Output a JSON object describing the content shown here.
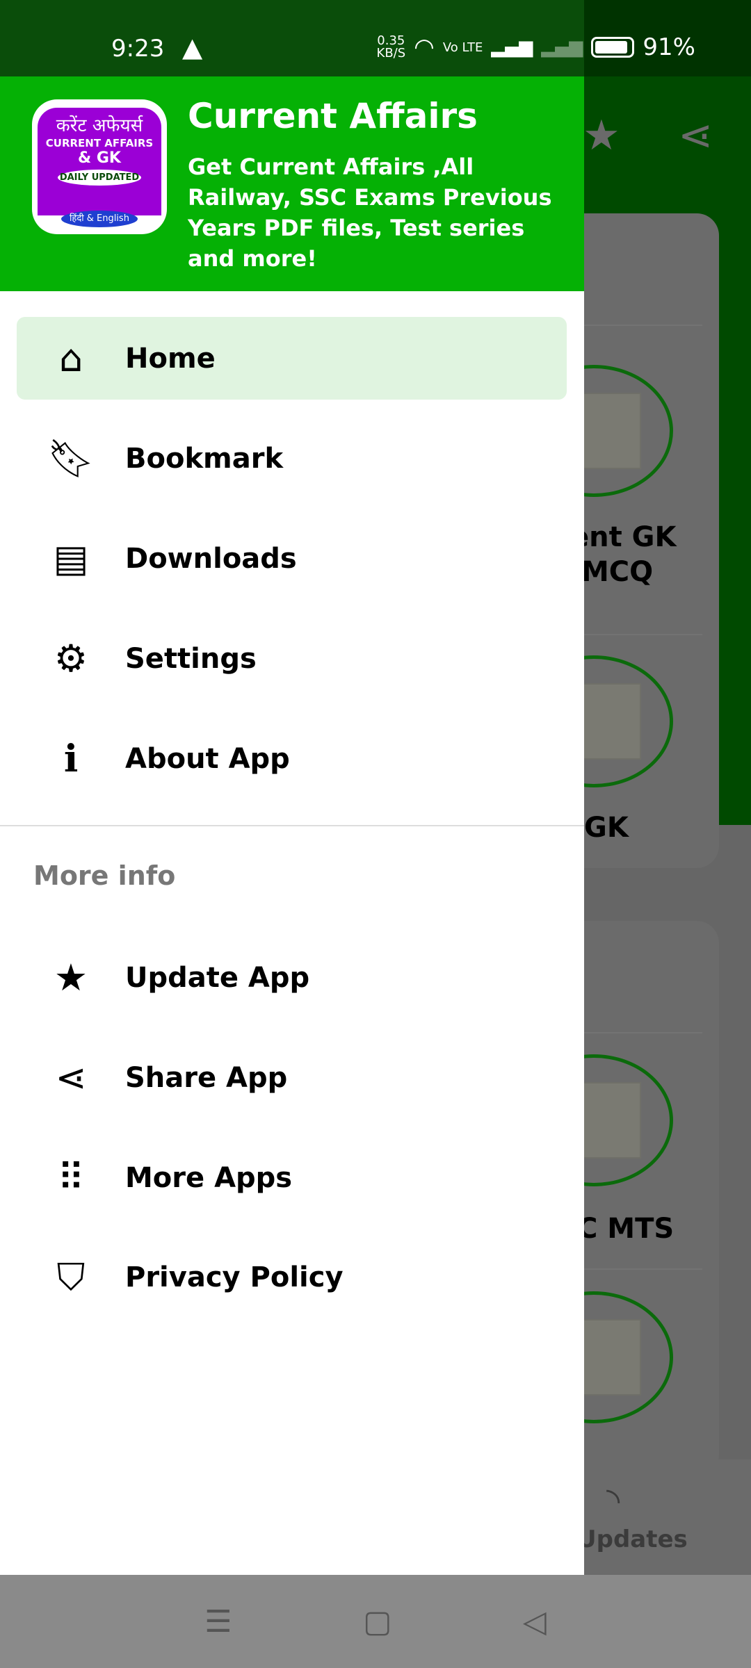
{
  "status_bar": {
    "time": "9:23",
    "net_speed": "0.35",
    "net_unit": "KB/S",
    "volte": "Vo LTE",
    "battery": "91%"
  },
  "background": {
    "cards": [
      "ent GK",
      "MCQ",
      "GK",
      "C MTS"
    ],
    "bottom_nav_label": "Updates"
  },
  "drawer": {
    "logo": {
      "hindi": "करेंट अफेयर्स",
      "line1": "CURRENT AFFAIRS",
      "line2": "& GK",
      "badge": "DAILY UPDATED",
      "lang": "हिंदी & English"
    },
    "title": "Current Affairs",
    "subtitle": "Get Current Affairs ,All Railway, SSC Exams Previous Years PDF files, Test series and more!",
    "items": [
      {
        "label": "Home",
        "icon": "home-icon",
        "active": true
      },
      {
        "label": "Bookmark",
        "icon": "bookmark-icon"
      },
      {
        "label": "Downloads",
        "icon": "library-icon"
      },
      {
        "label": "Settings",
        "icon": "gear-icon"
      },
      {
        "label": "About App",
        "icon": "info-icon"
      }
    ],
    "section_label": "More info",
    "more_items": [
      {
        "label": "Update App",
        "icon": "star-icon"
      },
      {
        "label": "Share App",
        "icon": "share-icon"
      },
      {
        "label": "More Apps",
        "icon": "apps-grid-icon"
      },
      {
        "label": "Privacy Policy",
        "icon": "shield-icon"
      }
    ]
  },
  "colors": {
    "header": "#05b105",
    "active_bg": "#e0f4e0",
    "toolbar": "#004a00"
  }
}
